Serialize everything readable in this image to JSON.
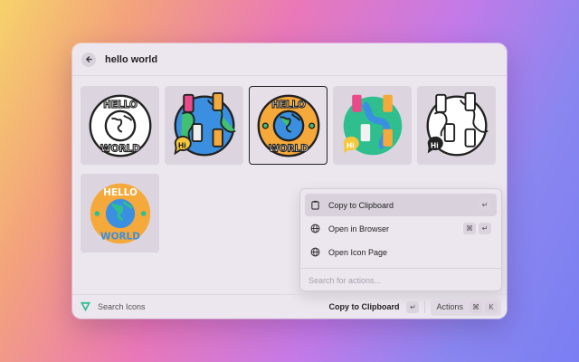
{
  "search": {
    "query": "hello world"
  },
  "icons": [
    {
      "name": "hello-world-outline-icon",
      "style": "outline"
    },
    {
      "name": "globe-phones-color-icon",
      "style": "color"
    },
    {
      "name": "hello-world-color-badge-icon",
      "style": "badge"
    },
    {
      "name": "globe-phones-flat-icon",
      "style": "flat"
    },
    {
      "name": "globe-phones-outline-icon",
      "style": "outline"
    },
    {
      "name": "hello-world-flat-badge-icon",
      "style": "badge-flat"
    }
  ],
  "actions_menu": {
    "items": [
      {
        "label": "Copy to Clipboard",
        "icon": "clipboard-icon",
        "shortcut": [
          "↵"
        ]
      },
      {
        "label": "Open in Browser",
        "icon": "globe-icon",
        "shortcut": [
          "⌘",
          "↵"
        ]
      },
      {
        "label": "Open Icon Page",
        "icon": "globe-icon",
        "shortcut": []
      }
    ],
    "search_placeholder": "Search for actions..."
  },
  "footer": {
    "title": "Search Icons",
    "primary_action": "Copy to Clipboard",
    "primary_shortcut": "↵",
    "actions_label": "Actions",
    "actions_shortcut": [
      "⌘",
      "K"
    ]
  },
  "colors": {
    "accent_green": "#2fbf8f",
    "globe_blue": "#3a8fe0",
    "badge_orange": "#f6a93b",
    "outline": "#222222"
  }
}
